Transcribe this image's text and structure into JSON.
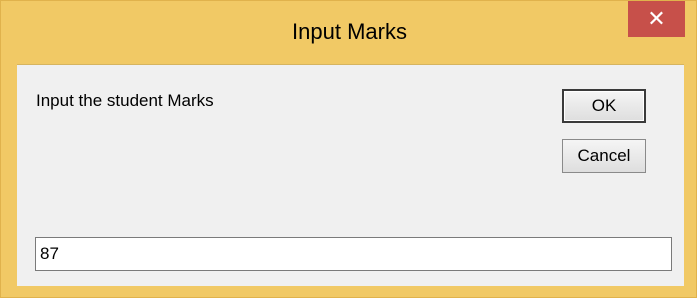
{
  "window": {
    "title": "Input Marks",
    "close_label": "✕"
  },
  "dialog": {
    "prompt": "Input the student Marks",
    "ok_label": "OK",
    "cancel_label": "Cancel",
    "input_value": "87"
  },
  "colors": {
    "frame": "#f1c965",
    "close_button": "#c7504a",
    "client_background": "#f0f0f0"
  },
  "icons": {
    "close": "close-icon"
  }
}
